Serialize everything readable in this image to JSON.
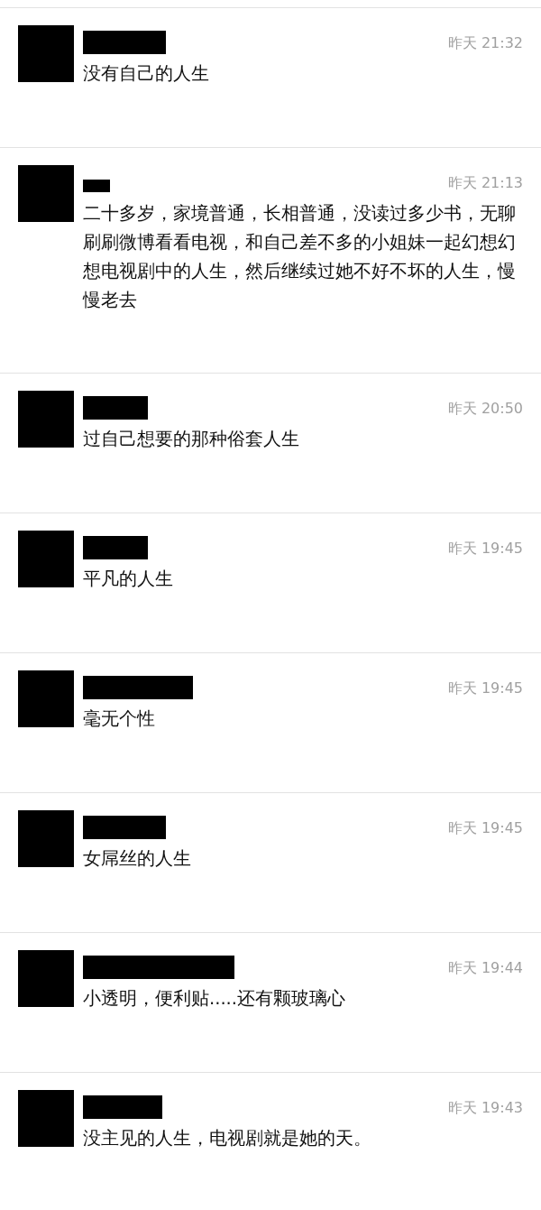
{
  "comments": [
    {
      "time": "昨天 21:32",
      "text": "没有自己的人生"
    },
    {
      "time": "昨天 21:13",
      "text": "二十多岁，家境普通，长相普通，没读过多少书，无聊刷刷微博看看电视，和自己差不多的小姐妹一起幻想幻想电视剧中的人生，然后继续过她不好不坏的人生，慢慢老去"
    },
    {
      "time": "昨天 20:50",
      "text": "过自己想要的那种俗套人生"
    },
    {
      "time": "昨天 19:45",
      "text": "平凡的人生"
    },
    {
      "time": "昨天 19:45",
      "text": "毫无个性"
    },
    {
      "time": "昨天 19:45",
      "text": "女屌丝的人生"
    },
    {
      "time": "昨天 19:44",
      "text": "小透明，便利贴.....还有颗玻璃心"
    },
    {
      "time": "昨天 19:43",
      "text": "没主见的人生，电视剧就是她的天。"
    }
  ]
}
